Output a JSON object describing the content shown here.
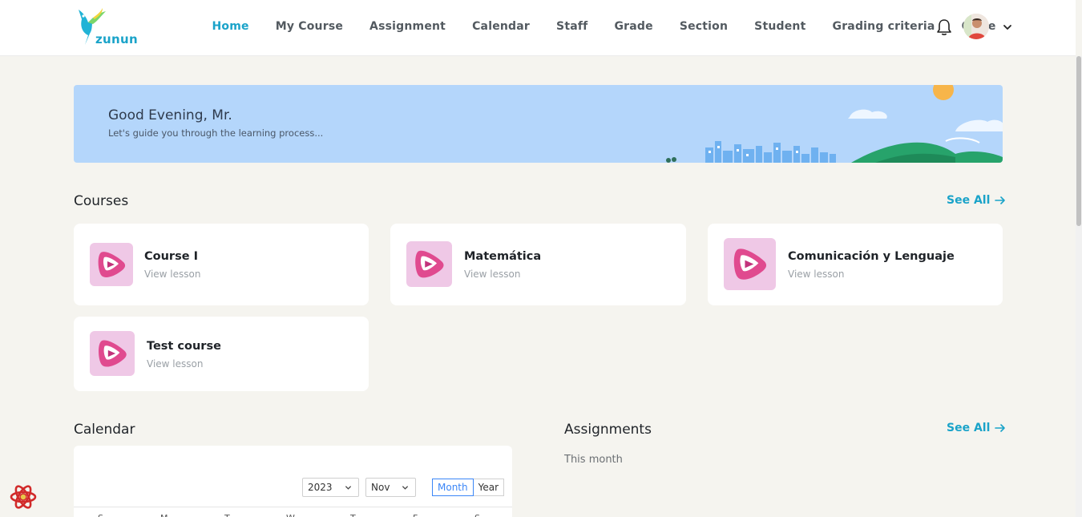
{
  "brand": {
    "name": "zunun"
  },
  "nav": {
    "items": [
      {
        "label": "Home",
        "active": true
      },
      {
        "label": "My Course",
        "active": false
      },
      {
        "label": "Assignment",
        "active": false
      },
      {
        "label": "Calendar",
        "active": false
      },
      {
        "label": "Staff",
        "active": false
      },
      {
        "label": "Grade",
        "active": false
      },
      {
        "label": "Section",
        "active": false
      },
      {
        "label": "Student",
        "active": false
      },
      {
        "label": "Grading criteria",
        "active": false
      },
      {
        "label": "Cycle",
        "active": false
      }
    ],
    "icons": [
      "bell-icon",
      "avatar",
      "chevron-down-icon"
    ]
  },
  "banner": {
    "greeting": "Good Evening, Mr.",
    "subtitle": "Let's guide you through the learning process..."
  },
  "courses": {
    "title": "Courses",
    "see_all": "See All",
    "items": [
      {
        "name": "Course I",
        "link": "View lesson"
      },
      {
        "name": "Matemática",
        "link": "View lesson"
      },
      {
        "name": "Comunicación y Lenguaje",
        "link": "View lesson"
      },
      {
        "name": "Test course",
        "link": "View lesson"
      }
    ]
  },
  "calendar": {
    "title": "Calendar",
    "year": "2023",
    "month": "Nov",
    "modes": [
      "Month",
      "Year"
    ],
    "active_mode": "Month",
    "weekdays": [
      "S",
      "M",
      "T",
      "W",
      "T",
      "F",
      "S"
    ]
  },
  "assignments": {
    "title": "Assignments",
    "see_all": "See All",
    "period": "This month"
  },
  "colors": {
    "accent": "#1aa3c9",
    "background": "#f5f4ef",
    "banner": "#b4d6fb",
    "thumb": "#efc8e6",
    "segment_active": "#3b86f7"
  }
}
